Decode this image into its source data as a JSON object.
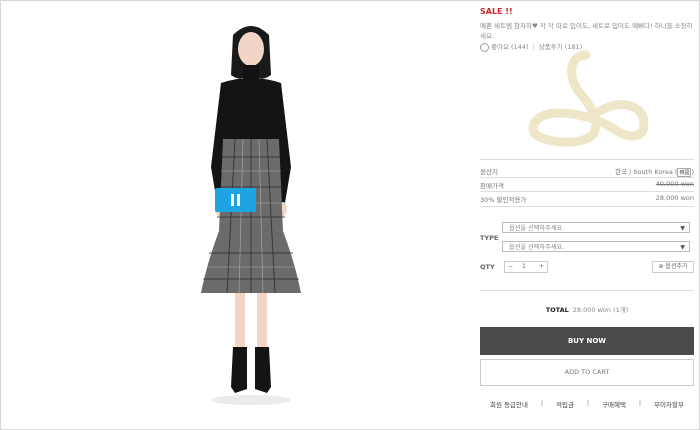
{
  "product": {
    "sale_label": "SALE !!",
    "description": "예쁜 세트템 참차하♥ 각 각 따로 입어도, 세트로 입어도 예뻐다! 하니들 소장하세요.",
    "likes": "좋아요 (144)",
    "reviews": "상품후기 (181)"
  },
  "details": {
    "origin_label": "원산지",
    "origin_value": "한국 / South Korea",
    "origin_badge": "韓國",
    "price_label": "판매가격",
    "price_value": "40,000 won",
    "discount_label": "30% 할인적용가",
    "discount_value": "28,000 won"
  },
  "options": {
    "type_label": "TYPE",
    "select1_placeholder": "옵션을 선택하주세요.",
    "select2_placeholder": "옵션을 선택하주세요.",
    "qty_label": "QTY",
    "qty_value": "1",
    "qty_minus": "−",
    "qty_plus": "+",
    "add_option_label": "옵션추가"
  },
  "total": {
    "label": "TOTAL",
    "value": "28,000 won (1개)"
  },
  "actions": {
    "buy_now": "BUY NOW",
    "add_to_cart": "ADD TO CART"
  },
  "footer_links": [
    "회원 등급안내",
    "적립금",
    "구매혜택",
    "무이자할부"
  ],
  "icons": {
    "pause": "pause-icon",
    "like": "like-icon",
    "dropdown": "chevron-down-icon",
    "add": "plus-circle-icon",
    "logo": "brand-logo"
  },
  "colors": {
    "sale": "#c8262b",
    "pause_button": "#1fa4e3",
    "buy_button": "#4a4a4a",
    "logo": "#efe5c9"
  }
}
